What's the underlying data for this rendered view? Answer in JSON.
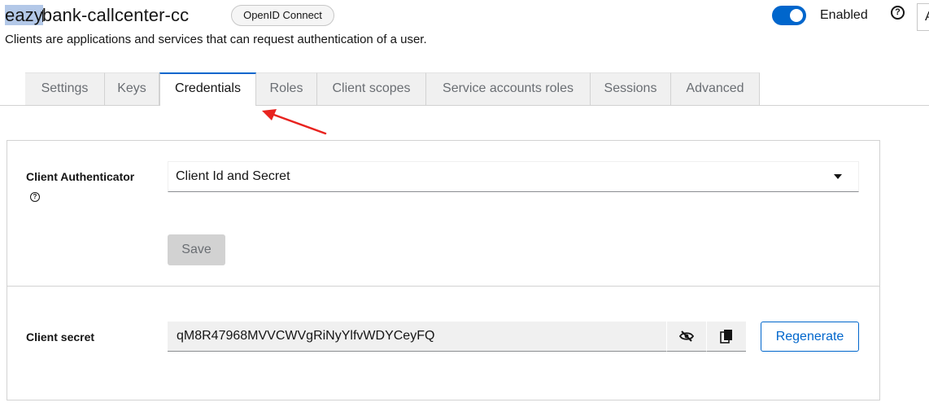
{
  "header": {
    "title_selected": "eazy",
    "title_rest": "bank-callcenter-cc",
    "protocol_badge": "OpenID Connect",
    "subtitle": "Clients are applications and services that can request authentication of a user.",
    "enabled_label": "Enabled",
    "action_partial": "A"
  },
  "tabs": [
    {
      "label": "Settings"
    },
    {
      "label": "Keys"
    },
    {
      "label": "Credentials"
    },
    {
      "label": "Roles"
    },
    {
      "label": "Client scopes"
    },
    {
      "label": "Service accounts roles"
    },
    {
      "label": "Sessions"
    },
    {
      "label": "Advanced"
    }
  ],
  "active_tab": "Credentials",
  "credentials": {
    "authenticator_label": "Client Authenticator",
    "authenticator_value": "Client Id and Secret",
    "save_label": "Save",
    "secret_label": "Client secret",
    "secret_value": "qM8R47968MVVCWVgRiNyYlfvWDYCeyFQ",
    "regenerate_label": "Regenerate"
  },
  "colors": {
    "accent": "#0066cc",
    "annotation_arrow": "#e8231f",
    "selection": "#b3c8e8"
  },
  "icons": {
    "toggle_visibility": "eye-slash-icon",
    "copy": "copy-icon",
    "help": "help-icon",
    "dropdown": "caret-down-icon"
  }
}
